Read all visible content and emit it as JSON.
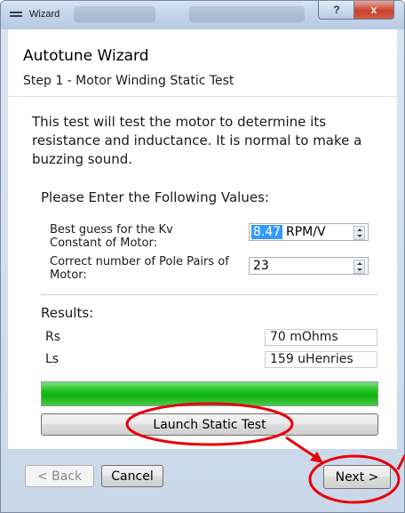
{
  "window": {
    "title": "Wizard",
    "help_label": "?",
    "close_label": "x"
  },
  "header": {
    "wizard_title": "Autotune Wizard",
    "step_title": "Step 1 - Motor Winding Static Test"
  },
  "content": {
    "description": "This test will test the motor to determine its resistance and inductance. It is normal to make a buzzing sound.",
    "prompt": "Please Enter the Following Values:",
    "kv_field": {
      "label": "Best guess for the Kv Constant of Motor:",
      "value": "8.47",
      "unit": "RPM/V"
    },
    "pole_field": {
      "label": "Correct number of Pole Pairs of Motor:",
      "value": "23"
    },
    "results": {
      "label": "Results:",
      "rs": {
        "label": "Rs",
        "value": "70 mOhms"
      },
      "ls": {
        "label": "Ls",
        "value": "159 uHenries"
      }
    },
    "progress_percent": 100,
    "launch_label": "Launch Static Test"
  },
  "footer": {
    "back_label": "< Back",
    "cancel_label": "Cancel",
    "next_label": "Next >"
  },
  "colors": {
    "annotation_red": "#e8000b",
    "progress_green": "#1fc21f",
    "titlebar_blue": "#c3d4ea"
  }
}
